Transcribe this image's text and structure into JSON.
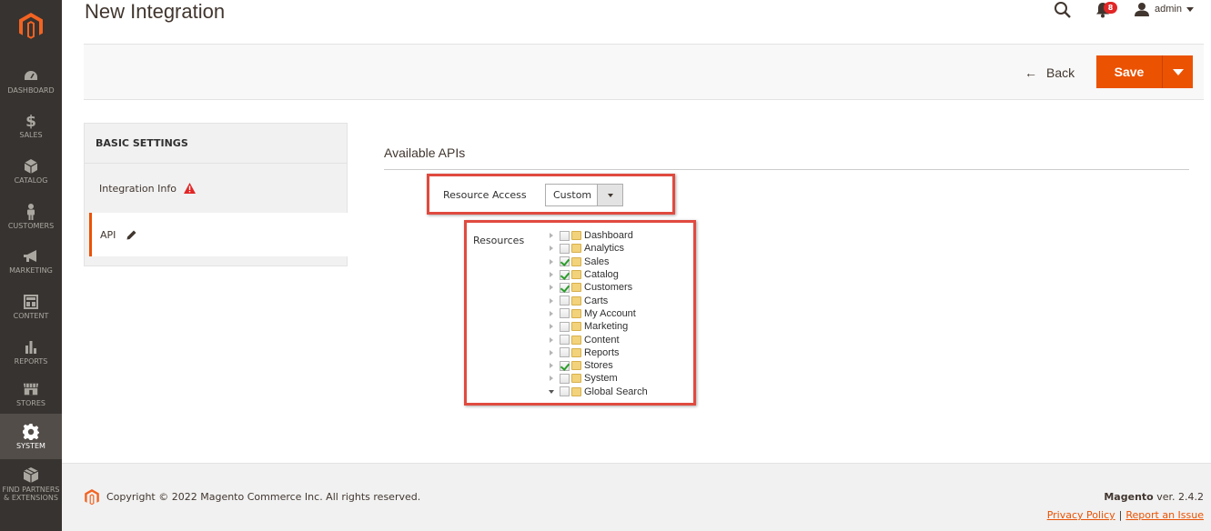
{
  "header": {
    "title": "New Integration",
    "notification_count": "8",
    "user_name": "admin"
  },
  "sidebar": {
    "items": [
      {
        "label": "DASHBOARD",
        "icon": "dashboard-icon"
      },
      {
        "label": "SALES",
        "icon": "dollar-icon"
      },
      {
        "label": "CATALOG",
        "icon": "cube-icon"
      },
      {
        "label": "CUSTOMERS",
        "icon": "person-icon"
      },
      {
        "label": "MARKETING",
        "icon": "megaphone-icon"
      },
      {
        "label": "CONTENT",
        "icon": "layout-icon"
      },
      {
        "label": "REPORTS",
        "icon": "bar-chart-icon"
      },
      {
        "label": "STORES",
        "icon": "storefront-icon"
      },
      {
        "label": "SYSTEM",
        "icon": "gear-icon"
      },
      {
        "label": "FIND PARTNERS & EXTENSIONS",
        "icon": "box-icon"
      }
    ],
    "active": "SYSTEM"
  },
  "actions": {
    "back_label": "Back",
    "save_label": "Save"
  },
  "tabs": {
    "title": "BASIC SETTINGS",
    "items": [
      {
        "label": "Integration Info",
        "icon": "warning-icon"
      },
      {
        "label": "API",
        "icon": "pencil-icon"
      }
    ]
  },
  "main": {
    "section_title": "Available APIs",
    "resource_access_label": "Resource Access",
    "resource_access_value": "Custom",
    "resources_label": "Resources",
    "resources": [
      {
        "name": "Dashboard",
        "checked": false
      },
      {
        "name": "Analytics",
        "checked": false
      },
      {
        "name": "Sales",
        "checked": true
      },
      {
        "name": "Catalog",
        "checked": true
      },
      {
        "name": "Customers",
        "checked": true
      },
      {
        "name": "Carts",
        "checked": false
      },
      {
        "name": "My Account",
        "checked": false
      },
      {
        "name": "Marketing",
        "checked": false
      },
      {
        "name": "Content",
        "checked": false
      },
      {
        "name": "Reports",
        "checked": false
      },
      {
        "name": "Stores",
        "checked": true
      },
      {
        "name": "System",
        "checked": false
      },
      {
        "name": "Global Search",
        "checked": false,
        "expanded": true
      }
    ]
  },
  "footer": {
    "copyright": "Copyright © 2022 Magento Commerce Inc. All rights reserved.",
    "brand": "Magento",
    "version": " ver. 2.4.2",
    "privacy_label": "Privacy Policy",
    "separator": "|",
    "report_label": "Report an Issue"
  },
  "colors": {
    "accent": "#eb5202",
    "sidebar_bg": "#373330",
    "highlight_border": "#e04a3f"
  }
}
